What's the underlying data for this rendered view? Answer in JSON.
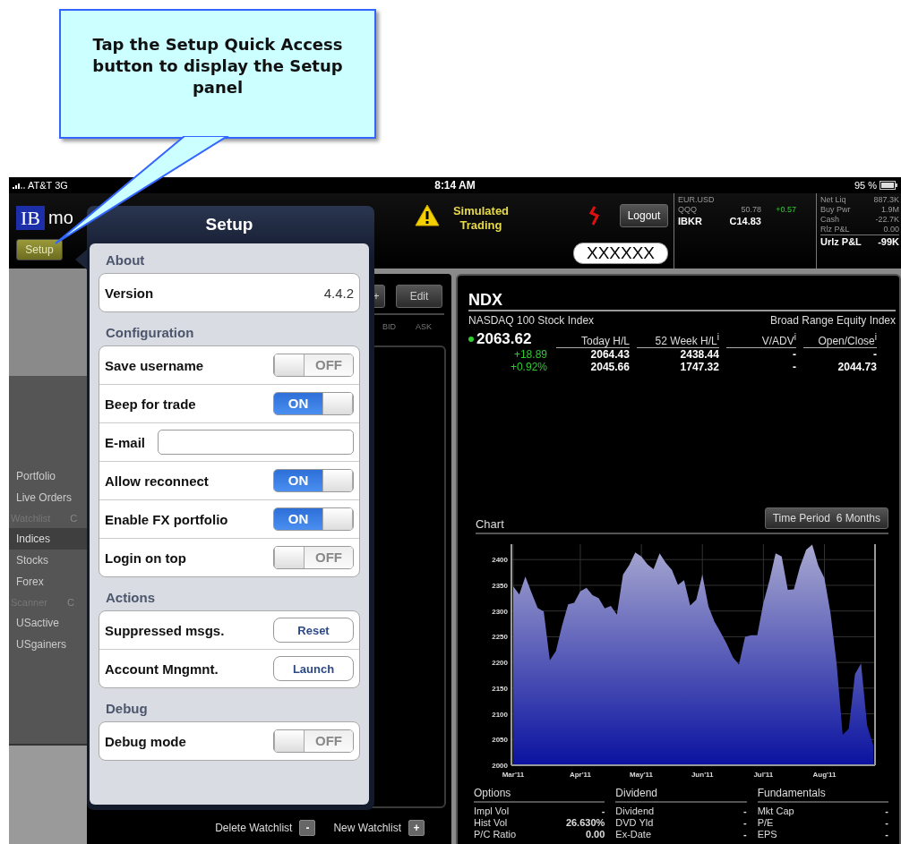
{
  "callout": {
    "text": "Tap the Setup Quick Access button to display the Setup panel"
  },
  "status_bar": {
    "carrier": "AT&T 3G",
    "time": "8:14 AM",
    "battery": "95 %"
  },
  "header": {
    "logo": "IB",
    "logo_text": "mo",
    "setup_button": "Setup",
    "notice": "Simulated Trading",
    "logout": "Logout",
    "account_id": "XXXXXX",
    "quotes": [
      {
        "symbol": "EUR.USD",
        "highlighted": false
      },
      {
        "symbol": "QQQ",
        "last": "50.78",
        "change": "+0.57",
        "highlighted": false
      },
      {
        "symbol": "IBKR",
        "last": "C14.83",
        "highlighted": true
      }
    ],
    "account": [
      {
        "label": "Net Liq",
        "value": "887.3K",
        "highlighted": false
      },
      {
        "label": "Buy Pwr",
        "value": "1.9M",
        "highlighted": false
      },
      {
        "label": "Cash",
        "value": "-22.7K",
        "highlighted": false
      },
      {
        "label": "Rlz P&L",
        "value": "0.00",
        "highlighted": false
      },
      {
        "label": "Urlz P&L",
        "value": "-99K",
        "highlighted": true
      }
    ]
  },
  "sidebar": {
    "items": [
      {
        "kind": "item",
        "label": "Portfolio",
        "selected": false
      },
      {
        "kind": "item",
        "label": "Live Orders",
        "selected": false
      },
      {
        "kind": "header",
        "label": "Watchlist",
        "suffix": "C"
      },
      {
        "kind": "item",
        "label": "Indices",
        "selected": true
      },
      {
        "kind": "item",
        "label": "Stocks",
        "selected": false
      },
      {
        "kind": "item",
        "label": "Forex",
        "selected": false
      },
      {
        "kind": "header",
        "label": "Scanner",
        "suffix": "C"
      },
      {
        "kind": "item",
        "label": "USactive",
        "selected": false
      },
      {
        "kind": "item",
        "label": "USgainers",
        "selected": false
      }
    ]
  },
  "watchlist": {
    "buttons": [
      "+",
      "Edit"
    ],
    "columns": [
      "BID",
      "ASK"
    ],
    "delete_label": "Delete Watchlist",
    "delete_icon": "-",
    "new_label": "New Watchlist",
    "new_icon": "+"
  },
  "detail": {
    "symbol": "NDX",
    "name": "NASDAQ 100 Stock Index",
    "category": "Broad Range Equity Index",
    "last": "2063.62",
    "change_up": true,
    "change": "+18.89",
    "change_pct": "+0.92%",
    "columns": [
      {
        "heading": "Today H/L",
        "values": [
          "2064.43",
          "2045.66"
        ]
      },
      {
        "heading": "52 Week H/L$^{i}$",
        "values": [
          "2438.44",
          "1747.32"
        ]
      },
      {
        "heading": "V/ADV$^{i}$",
        "values": [
          "-",
          "-"
        ]
      },
      {
        "heading": "Open/Close$^{i}$",
        "values": [
          "-",
          "2044.73"
        ]
      }
    ],
    "chart": {
      "title": "Chart",
      "period_button": "Time Period  6 Months",
      "chart_data": {
        "type": "area",
        "grid": true,
        "ylim": [
          2000,
          2430
        ],
        "categories": [
          "Mar'11",
          null,
          null,
          null,
          null,
          null,
          null,
          null,
          null,
          null,
          null,
          "Apr'11",
          null,
          null,
          null,
          null,
          null,
          null,
          null,
          null,
          null,
          "May'11",
          null,
          null,
          null,
          null,
          null,
          null,
          null,
          null,
          null,
          "Jun'11",
          null,
          null,
          null,
          null,
          null,
          null,
          null,
          null,
          null,
          "Jul'11",
          null,
          null,
          null,
          null,
          null,
          null,
          null,
          null,
          null,
          "Aug'11",
          null,
          null,
          null,
          null,
          null,
          null,
          null,
          null
        ],
        "yticks": [
          2000,
          2050,
          2100,
          2150,
          2200,
          2250,
          2300,
          2350,
          2400
        ],
        "series": [
          {
            "color": "#0a12a0",
            "values": [
              2348,
              2332,
              2367,
              2336,
              2306,
              2299,
              2204,
              2222,
              2271,
              2313,
              2316,
              2338,
              2345,
              2331,
              2325,
              2305,
              2310,
              2293,
              2371,
              2389,
              2414,
              2406,
              2391,
              2381,
              2412,
              2394,
              2380,
              2351,
              2360,
              2311,
              2322,
              2371,
              2309,
              2279,
              2258,
              2236,
              2210,
              2196,
              2250,
              2253,
              2253,
              2316,
              2360,
              2412,
              2406,
              2341,
              2342,
              2386,
              2419,
              2429,
              2388,
              2364,
              2296,
              2198,
              2059,
              2071,
              2177,
              2198,
              2077,
              2039
            ]
          }
        ]
      }
    },
    "sections": [
      {
        "title": "Options",
        "rows": [
          {
            "label": "Impl Vol",
            "value": "-"
          },
          {
            "label": "Hist Vol",
            "value": "26.630%"
          },
          {
            "label": "P/C Ratio",
            "value": "0.00"
          }
        ]
      },
      {
        "title": "Dividend",
        "rows": [
          {
            "label": "Dividend",
            "value": "-"
          },
          {
            "label": "DVD Yld",
            "value": "-"
          },
          {
            "label": "Ex-Date",
            "value": "-"
          }
        ]
      },
      {
        "title": "Fundamentals",
        "rows": [
          {
            "label": "Mkt Cap",
            "value": "-"
          },
          {
            "label": "P/E",
            "value": "-"
          },
          {
            "label": "EPS",
            "value": "-"
          }
        ]
      }
    ]
  },
  "setup": {
    "title": "Setup",
    "sections": [
      {
        "title": "About",
        "rows": [
          {
            "kind": "value",
            "label": "Version",
            "value": "4.4.2"
          }
        ]
      },
      {
        "title": "Configuration",
        "rows": [
          {
            "kind": "switch",
            "label": "Save username",
            "on": false,
            "caption": "OFF"
          },
          {
            "kind": "switch",
            "label": "Beep for trade",
            "on": true,
            "caption": "ON"
          },
          {
            "kind": "field",
            "label": "E-mail"
          },
          {
            "kind": "switch",
            "label": "Allow reconnect",
            "on": true,
            "caption": "ON"
          },
          {
            "kind": "switch",
            "label": "Enable FX portfolio",
            "on": true,
            "caption": "ON"
          },
          {
            "kind": "switch",
            "label": "Login on top",
            "on": false,
            "caption": "OFF"
          }
        ]
      },
      {
        "title": "Actions",
        "rows": [
          {
            "kind": "button",
            "label": "Suppressed msgs.",
            "button": "Reset"
          },
          {
            "kind": "button",
            "label": "Account Mngmnt.",
            "button": "Launch"
          }
        ]
      },
      {
        "title": "Debug",
        "rows": [
          {
            "kind": "switch",
            "label": "Debug mode",
            "on": false,
            "caption": "OFF"
          }
        ]
      }
    ]
  }
}
